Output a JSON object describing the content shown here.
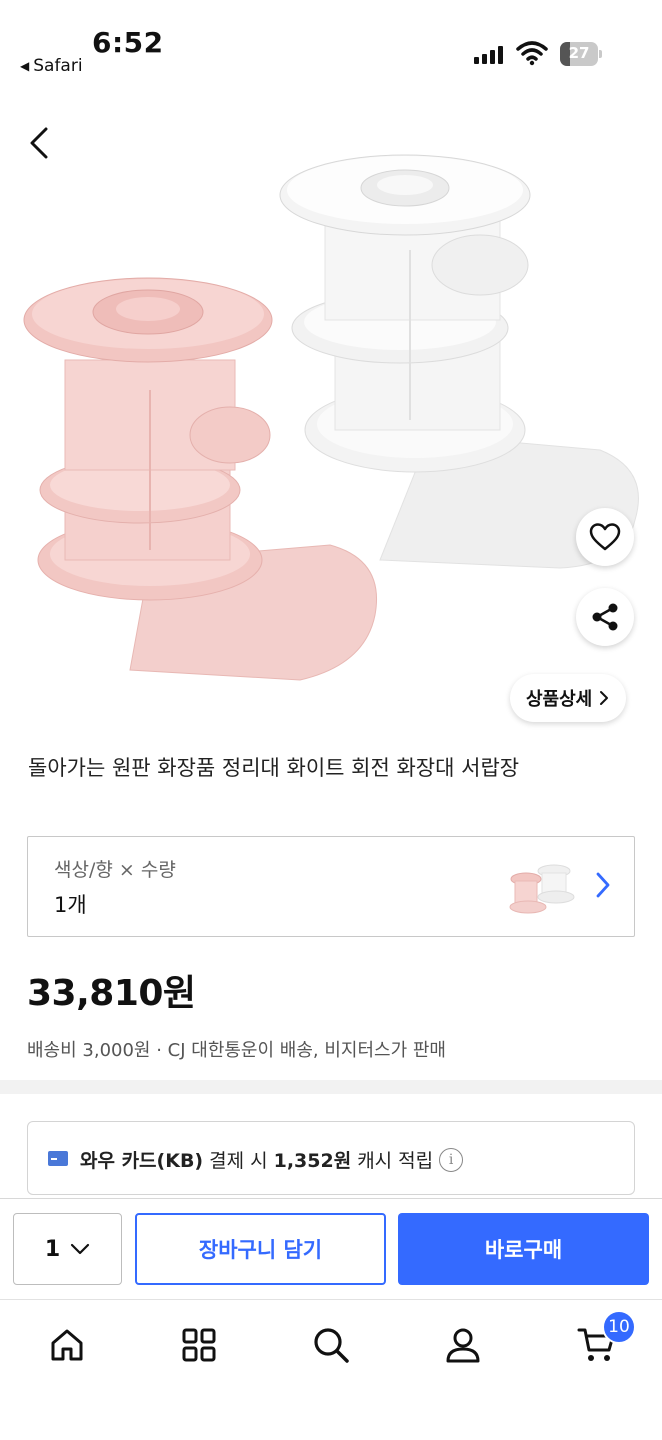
{
  "status_bar": {
    "time": "6:52",
    "back_app": "Safari",
    "battery": "27",
    "battery_level": 0.27
  },
  "hero": {
    "detail_button": "상품상세",
    "icons": [
      "back-arrow-icon",
      "heart-icon",
      "share-icon",
      "chevron-right-icon"
    ],
    "product_colors": {
      "pink": "#f2c9c6",
      "white": "#f4f4f4"
    }
  },
  "product": {
    "title": "돌아가는 원판 화장품 정리대 화이트 회전 화장대 서랍장",
    "option_label": "색상/향 × 수량",
    "option_value": "1개",
    "price": "33,810원",
    "shipping": "배송비 3,000원 · CJ 대한통운이 배송, 비지터스가 판매"
  },
  "card_promo": {
    "prefix": "와우 카드(KB)",
    "middle": "결제 시",
    "amount": "1,352원",
    "suffix": "캐시 적립",
    "info": "i"
  },
  "action_bar": {
    "quantity": "1",
    "cart_label": "장바구니 담기",
    "buy_label": "바로구매"
  },
  "tab_bar": {
    "tabs": [
      "home-icon",
      "category-grid-icon",
      "search-icon",
      "my-page-icon",
      "cart-icon"
    ],
    "cart_badge": "10"
  },
  "colors": {
    "accent": "#346aff",
    "text": "#111111",
    "muted": "#555555"
  }
}
